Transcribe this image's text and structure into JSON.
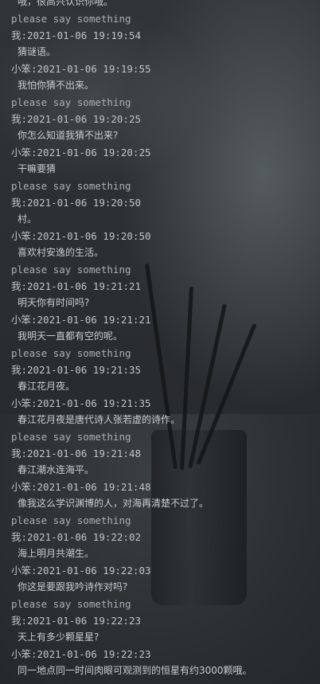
{
  "console": {
    "lines": [
      {
        "kind": "msg",
        "text": "哦，很高兴认识你哦。"
      },
      {
        "kind": "prompt",
        "text": "please say something"
      },
      {
        "kind": "header",
        "text": "我:2021-01-06 19:19:54"
      },
      {
        "kind": "msg",
        "text": "猜谜语。"
      },
      {
        "kind": "header",
        "text": "小笨:2021-01-06 19:19:55"
      },
      {
        "kind": "msg",
        "text": "我怕你猜不出来。"
      },
      {
        "kind": "prompt",
        "text": "please say something"
      },
      {
        "kind": "header",
        "text": "我:2021-01-06 19:20:25"
      },
      {
        "kind": "msg",
        "text": "你怎么知道我猜不出来?"
      },
      {
        "kind": "header",
        "text": "小笨:2021-01-06 19:20:25"
      },
      {
        "kind": "msg",
        "text": "干嘛要猜"
      },
      {
        "kind": "prompt",
        "text": "please say something"
      },
      {
        "kind": "header",
        "text": "我:2021-01-06 19:20:50"
      },
      {
        "kind": "msg",
        "text": "村。"
      },
      {
        "kind": "header",
        "text": "小笨:2021-01-06 19:20:50"
      },
      {
        "kind": "msg",
        "text": "喜欢村安逸的生活。"
      },
      {
        "kind": "prompt",
        "text": "please say something"
      },
      {
        "kind": "header",
        "text": "我:2021-01-06 19:21:21"
      },
      {
        "kind": "msg",
        "text": "明天你有时间吗?"
      },
      {
        "kind": "header",
        "text": "小笨:2021-01-06 19:21:21"
      },
      {
        "kind": "msg",
        "text": "我明天一直都有空的呢。"
      },
      {
        "kind": "prompt",
        "text": "please say something"
      },
      {
        "kind": "header",
        "text": "我:2021-01-06 19:21:35"
      },
      {
        "kind": "msg",
        "text": "春江花月夜。"
      },
      {
        "kind": "header",
        "text": "小笨:2021-01-06 19:21:35"
      },
      {
        "kind": "msg",
        "text": "春江花月夜是唐代诗人张若虚的诗作。"
      },
      {
        "kind": "prompt",
        "text": "please say something"
      },
      {
        "kind": "header",
        "text": "我:2021-01-06 19:21:48"
      },
      {
        "kind": "msg",
        "text": "春江潮水连海平。"
      },
      {
        "kind": "header",
        "text": "小笨:2021-01-06 19:21:48"
      },
      {
        "kind": "msg",
        "text": "像我这么学识渊博的人，对海再清楚不过了。"
      },
      {
        "kind": "prompt",
        "text": "please say something"
      },
      {
        "kind": "header",
        "text": "我:2021-01-06 19:22:02"
      },
      {
        "kind": "msg",
        "text": "海上明月共潮生。"
      },
      {
        "kind": "header",
        "text": "小笨:2021-01-06 19:22:03"
      },
      {
        "kind": "msg",
        "text": "你这是要跟我吟诗作对吗?"
      },
      {
        "kind": "prompt",
        "text": "please say something"
      },
      {
        "kind": "header",
        "text": "我:2021-01-06 19:22:23"
      },
      {
        "kind": "msg",
        "text": "天上有多少颗星星?"
      },
      {
        "kind": "header",
        "text": "小笨:2021-01-06 19:22:23"
      },
      {
        "kind": "msg",
        "text": "同一地点同一时间肉眼可观测到的恒星有约3000颗哦。"
      }
    ]
  }
}
